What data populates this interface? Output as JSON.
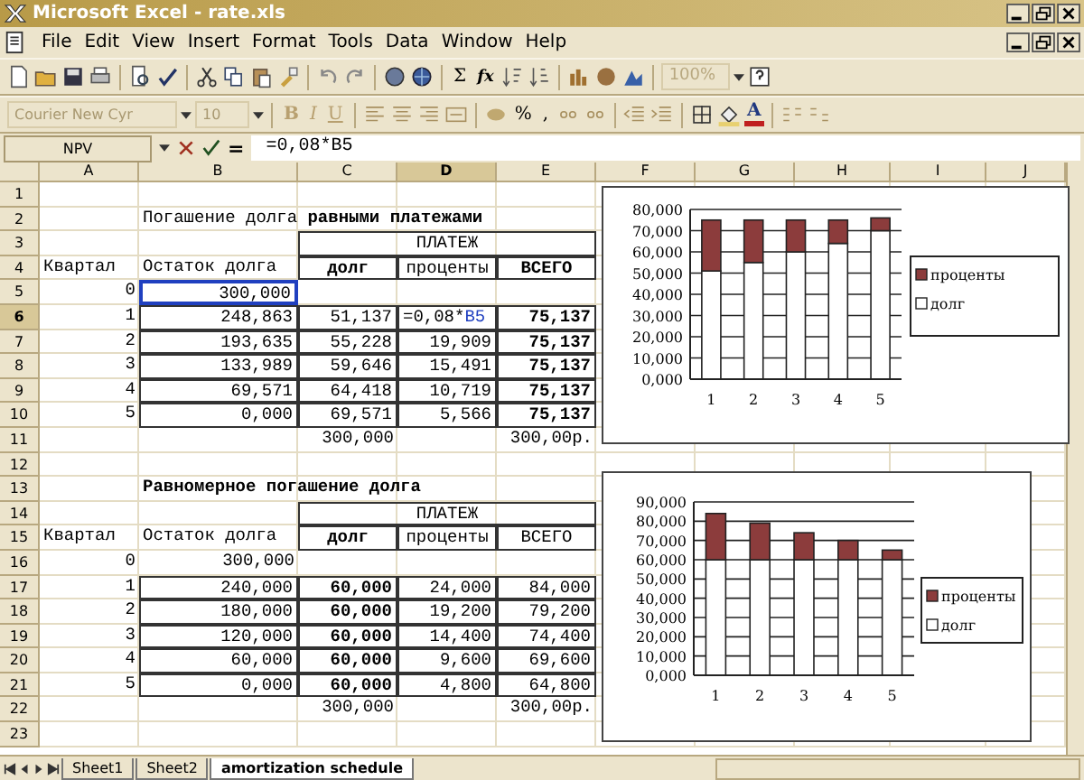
{
  "window": {
    "title": "Microsoft Excel - rate.xls"
  },
  "menu": [
    "File",
    "Edit",
    "View",
    "Insert",
    "Format",
    "Tools",
    "Data",
    "Window",
    "Help"
  ],
  "toolbar": {
    "sum": "Σ",
    "function": "fx",
    "zoom": "100%"
  },
  "format_bar": {
    "font": "Courier New Cyr",
    "size": "10",
    "bold": "B",
    "italic": "I",
    "underline": "U",
    "percent": "%",
    "comma": ",",
    "font_color": "A"
  },
  "formula_bar": {
    "name_box": "NPV",
    "equals": "=",
    "formula": "=0,08*B5"
  },
  "columns": [
    {
      "label": "A",
      "selected": false
    },
    {
      "label": "B",
      "selected": false
    },
    {
      "label": "C",
      "selected": false
    },
    {
      "label": "D",
      "selected": true
    },
    {
      "label": "E",
      "selected": false
    },
    {
      "label": "F",
      "selected": false
    },
    {
      "label": "G",
      "selected": false
    },
    {
      "label": "H",
      "selected": false
    },
    {
      "label": "I",
      "selected": false
    },
    {
      "label": "J",
      "selected": false
    }
  ],
  "rows": [
    {
      "label": "1",
      "selected": false,
      "cells": []
    },
    {
      "label": "2",
      "selected": false,
      "cells": [
        {
          "kind": "empty"
        },
        {
          "kind": "title",
          "text": "Погашение долга **равными платежами**",
          "bold": false,
          "boxed": false
        }
      ]
    },
    {
      "label": "3",
      "selected": false,
      "cells": [
        {
          "kind": "empty"
        },
        {
          "kind": "empty"
        },
        {
          "kind": "merged",
          "text": "ПЛАТЕЖ",
          "bold": false,
          "boxed": true
        }
      ]
    },
    {
      "label": "4",
      "selected": false,
      "cells": [
        {
          "kind": "text",
          "text": "Квартал",
          "bold": false,
          "boxed": false
        },
        {
          "kind": "text",
          "text": "Остаток долга",
          "bold": false,
          "boxed": false
        },
        {
          "kind": "header",
          "text": "долг",
          "bold": true,
          "boxed": true
        },
        {
          "kind": "header",
          "text": "проценты",
          "bold": false,
          "boxed": true
        },
        {
          "kind": "header",
          "text": "ВСЕГО",
          "bold": true,
          "boxed": true
        }
      ]
    },
    {
      "label": "5",
      "selected": false,
      "cells": [
        {
          "kind": "number",
          "text": "0",
          "bold": false,
          "boxed": false
        },
        {
          "kind": "reference",
          "text": "300,000",
          "bold": false,
          "boxed": false
        }
      ]
    },
    {
      "label": "6",
      "selected": true,
      "cells": [
        {
          "kind": "number",
          "text": "1",
          "bold": false,
          "boxed": false
        },
        {
          "kind": "number",
          "text": "248,863",
          "bold": false,
          "boxed": true
        },
        {
          "kind": "number",
          "text": "51,137",
          "bold": false,
          "boxed": true
        },
        {
          "kind": "editing",
          "text": "=0,08*",
          "ref": "B5",
          "bold": false,
          "boxed": true
        },
        {
          "kind": "number",
          "text": "75,137",
          "bold": true,
          "boxed": true
        }
      ]
    },
    {
      "label": "7",
      "selected": false,
      "cells": [
        {
          "kind": "number",
          "text": "2",
          "bold": false,
          "boxed": false
        },
        {
          "kind": "number",
          "text": "193,635",
          "bold": false,
          "boxed": true
        },
        {
          "kind": "number",
          "text": "55,228",
          "bold": false,
          "boxed": true
        },
        {
          "kind": "number",
          "text": "19,909",
          "bold": false,
          "boxed": true
        },
        {
          "kind": "number",
          "text": "75,137",
          "bold": true,
          "boxed": true
        }
      ]
    },
    {
      "label": "8",
      "selected": false,
      "cells": [
        {
          "kind": "number",
          "text": "3",
          "bold": false,
          "boxed": false
        },
        {
          "kind": "number",
          "text": "133,989",
          "bold": false,
          "boxed": true
        },
        {
          "kind": "number",
          "text": "59,646",
          "bold": false,
          "boxed": true
        },
        {
          "kind": "number",
          "text": "15,491",
          "bold": false,
          "boxed": true
        },
        {
          "kind": "number",
          "text": "75,137",
          "bold": true,
          "boxed": true
        }
      ]
    },
    {
      "label": "9",
      "selected": false,
      "cells": [
        {
          "kind": "number",
          "text": "4",
          "bold": false,
          "boxed": false
        },
        {
          "kind": "number",
          "text": "69,571",
          "bold": false,
          "boxed": true
        },
        {
          "kind": "number",
          "text": "64,418",
          "bold": false,
          "boxed": true
        },
        {
          "kind": "number",
          "text": "10,719",
          "bold": false,
          "boxed": true
        },
        {
          "kind": "number",
          "text": "75,137",
          "bold": true,
          "boxed": true
        }
      ]
    },
    {
      "label": "10",
      "selected": false,
      "cells": [
        {
          "kind": "number",
          "text": "5",
          "bold": false,
          "boxed": false
        },
        {
          "kind": "number",
          "text": "0,000",
          "bold": false,
          "boxed": true
        },
        {
          "kind": "number",
          "text": "69,571",
          "bold": false,
          "boxed": true
        },
        {
          "kind": "number",
          "text": "5,566",
          "bold": false,
          "boxed": true
        },
        {
          "kind": "number",
          "text": "75,137",
          "bold": true,
          "boxed": true
        }
      ]
    },
    {
      "label": "11",
      "selected": false,
      "cells": [
        {
          "kind": "empty"
        },
        {
          "kind": "empty"
        },
        {
          "kind": "number",
          "text": "300,000",
          "bold": false,
          "boxed": false
        },
        {
          "kind": "empty"
        },
        {
          "kind": "number",
          "text": "300,00р.",
          "bold": false,
          "boxed": false
        }
      ]
    },
    {
      "label": "12",
      "selected": false,
      "cells": []
    },
    {
      "label": "13",
      "selected": false,
      "cells": [
        {
          "kind": "empty"
        },
        {
          "kind": "title",
          "text": "Равномерное погашение долга",
          "bold": true,
          "boxed": false
        }
      ]
    },
    {
      "label": "14",
      "selected": false,
      "cells": [
        {
          "kind": "empty"
        },
        {
          "kind": "empty"
        },
        {
          "kind": "merged",
          "text": "ПЛАТЕЖ",
          "bold": false,
          "boxed": true
        }
      ]
    },
    {
      "label": "15",
      "selected": false,
      "cells": [
        {
          "kind": "text",
          "text": "Квартал",
          "bold": false,
          "boxed": false
        },
        {
          "kind": "text",
          "text": "Остаток долга",
          "bold": false,
          "boxed": false
        },
        {
          "kind": "header",
          "text": "долг",
          "bold": true,
          "boxed": true
        },
        {
          "kind": "header",
          "text": "проценты",
          "bold": false,
          "boxed": true
        },
        {
          "kind": "header",
          "text": "ВСЕГО",
          "bold": false,
          "boxed": true
        }
      ]
    },
    {
      "label": "16",
      "selected": false,
      "cells": [
        {
          "kind": "number",
          "text": "0",
          "bold": false,
          "boxed": false
        },
        {
          "kind": "number",
          "text": "300,000",
          "bold": false,
          "boxed": false
        }
      ]
    },
    {
      "label": "17",
      "selected": false,
      "cells": [
        {
          "kind": "number",
          "text": "1",
          "bold": false,
          "boxed": false
        },
        {
          "kind": "number",
          "text": "240,000",
          "bold": false,
          "boxed": true
        },
        {
          "kind": "number",
          "text": "60,000",
          "bold": true,
          "boxed": true
        },
        {
          "kind": "number",
          "text": "24,000",
          "bold": false,
          "boxed": true
        },
        {
          "kind": "number",
          "text": "84,000",
          "bold": false,
          "boxed": true
        }
      ]
    },
    {
      "label": "18",
      "selected": false,
      "cells": [
        {
          "kind": "number",
          "text": "2",
          "bold": false,
          "boxed": false
        },
        {
          "kind": "number",
          "text": "180,000",
          "bold": false,
          "boxed": true
        },
        {
          "kind": "number",
          "text": "60,000",
          "bold": true,
          "boxed": true
        },
        {
          "kind": "number",
          "text": "19,200",
          "bold": false,
          "boxed": true
        },
        {
          "kind": "number",
          "text": "79,200",
          "bold": false,
          "boxed": true
        }
      ]
    },
    {
      "label": "19",
      "selected": false,
      "cells": [
        {
          "kind": "number",
          "text": "3",
          "bold": false,
          "boxed": false
        },
        {
          "kind": "number",
          "text": "120,000",
          "bold": false,
          "boxed": true
        },
        {
          "kind": "number",
          "text": "60,000",
          "bold": true,
          "boxed": true
        },
        {
          "kind": "number",
          "text": "14,400",
          "bold": false,
          "boxed": true
        },
        {
          "kind": "number",
          "text": "74,400",
          "bold": false,
          "boxed": true
        }
      ]
    },
    {
      "label": "20",
      "selected": false,
      "cells": [
        {
          "kind": "number",
          "text": "4",
          "bold": false,
          "boxed": false
        },
        {
          "kind": "number",
          "text": "60,000",
          "bold": false,
          "boxed": true
        },
        {
          "kind": "number",
          "text": "60,000",
          "bold": true,
          "boxed": true
        },
        {
          "kind": "number",
          "text": "9,600",
          "bold": false,
          "boxed": true
        },
        {
          "kind": "number",
          "text": "69,600",
          "bold": false,
          "boxed": true
        }
      ]
    },
    {
      "label": "21",
      "selected": false,
      "cells": [
        {
          "kind": "number",
          "text": "5",
          "bold": false,
          "boxed": false
        },
        {
          "kind": "number",
          "text": "0,000",
          "bold": false,
          "boxed": true
        },
        {
          "kind": "number",
          "text": "60,000",
          "bold": true,
          "boxed": true
        },
        {
          "kind": "number",
          "text": "4,800",
          "bold": false,
          "boxed": true
        },
        {
          "kind": "number",
          "text": "64,800",
          "bold": false,
          "boxed": true
        }
      ]
    },
    {
      "label": "22",
      "selected": false,
      "cells": [
        {
          "kind": "empty"
        },
        {
          "kind": "empty"
        },
        {
          "kind": "number",
          "text": "300,000",
          "bold": false,
          "boxed": false
        },
        {
          "kind": "empty"
        },
        {
          "kind": "number",
          "text": "300,00р.",
          "bold": false,
          "boxed": false
        }
      ]
    },
    {
      "label": "23",
      "selected": false,
      "cells": []
    }
  ],
  "charts": [
    {
      "chart_data": {
        "type": "bar",
        "stacked": true,
        "grid": true,
        "legend": true,
        "categories": [
          "1",
          "2",
          "3",
          "4",
          "5"
        ],
        "series": [
          {
            "name": "долг",
            "color": "#ffffff",
            "values": [
              51,
              55,
              60,
              64,
              70
            ]
          },
          {
            "name": "проценты",
            "color": "#8c3c3c",
            "values": [
              24,
              20,
              15,
              11,
              6
            ]
          }
        ],
        "ylim": [
          0,
          80
        ],
        "yticks": [
          {
            "value": 0,
            "label": "0,000"
          },
          {
            "value": 10,
            "label": "10,000"
          },
          {
            "value": 20,
            "label": "20,000"
          },
          {
            "value": 30,
            "label": "30,000"
          },
          {
            "value": 40,
            "label": "40,000"
          },
          {
            "value": 50,
            "label": "50,000"
          },
          {
            "value": 60,
            "label": "60,000"
          },
          {
            "value": 70,
            "label": "70,000"
          },
          {
            "value": 80,
            "label": "80,000"
          }
        ]
      }
    },
    {
      "chart_data": {
        "type": "bar",
        "stacked": true,
        "grid": true,
        "legend": true,
        "categories": [
          "1",
          "2",
          "3",
          "4",
          "5"
        ],
        "series": [
          {
            "name": "долг",
            "color": "#ffffff",
            "values": [
              60,
              60,
              60,
              60,
              60
            ]
          },
          {
            "name": "проценты",
            "color": "#8c3c3c",
            "values": [
              24,
              19,
              14,
              10,
              5
            ]
          }
        ],
        "ylim": [
          0,
          90
        ],
        "yticks": [
          {
            "value": 0,
            "label": "0,000"
          },
          {
            "value": 10,
            "label": "10,000"
          },
          {
            "value": 20,
            "label": "20,000"
          },
          {
            "value": 30,
            "label": "30,000"
          },
          {
            "value": 40,
            "label": "40,000"
          },
          {
            "value": 50,
            "label": "50,000"
          },
          {
            "value": 60,
            "label": "60,000"
          },
          {
            "value": 70,
            "label": "70,000"
          },
          {
            "value": 80,
            "label": "80,000"
          },
          {
            "value": 90,
            "label": "90,000"
          }
        ]
      }
    }
  ],
  "sheet_tabs": [
    {
      "label": "Sheet1",
      "selected": false
    },
    {
      "label": "Sheet2",
      "selected": false
    },
    {
      "label": "amortization schedule",
      "selected": true
    }
  ]
}
